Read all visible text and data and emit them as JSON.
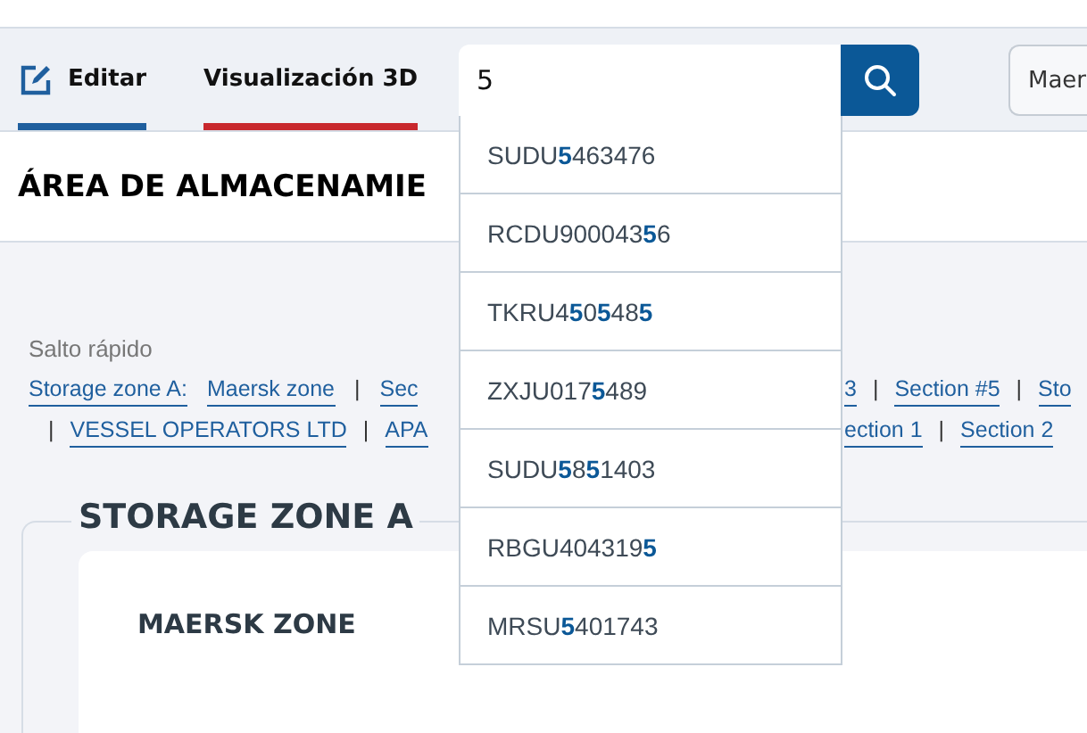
{
  "tabs": [
    {
      "label": "Editar",
      "kind": "edit",
      "selected": true
    },
    {
      "label": "Visualización 3D",
      "kind": "view",
      "selected": false
    }
  ],
  "search": {
    "value": "5"
  },
  "suggestions": [
    "SUDU**5**463476",
    "RCDU900043**5**6",
    "TKRU4**5**0**5**48**5**",
    "ZXJU017**5**489",
    "SUDU**5**8**5**1403",
    "RBGU404319**5**",
    "MRSU**5**401743"
  ],
  "toolbar_button": {
    "label": "Maer"
  },
  "page_title": "ÁREA DE ALMACENAMIE",
  "quick_jump": {
    "title": "Salto rápido",
    "lines": [
      {
        "before": [
          {
            "kind": "label",
            "text": "Storage zone A:"
          },
          {
            "kind": "link",
            "text": "Maersk zone"
          },
          {
            "kind": "separator",
            "text": "|"
          },
          {
            "kind": "link",
            "text": "Sec"
          }
        ],
        "after": [
          {
            "kind": "link",
            "text": "3"
          },
          {
            "kind": "separator",
            "text": "|"
          },
          {
            "kind": "link",
            "text": "Section #5"
          },
          {
            "kind": "separator",
            "text": "|"
          },
          {
            "kind": "link",
            "text": "Sto"
          }
        ]
      },
      {
        "before": [
          {
            "kind": "separator",
            "text": "|"
          },
          {
            "kind": "link",
            "text": "VESSEL OPERATORS LTD"
          },
          {
            "kind": "separator",
            "text": "|"
          },
          {
            "kind": "link",
            "text": "APA"
          }
        ],
        "after": [
          {
            "kind": "link",
            "text": "ection 1"
          },
          {
            "kind": "separator",
            "text": "|"
          },
          {
            "kind": "link",
            "text": "Section 2"
          }
        ]
      }
    ]
  },
  "zone": {
    "title": "STORAGE ZONE A",
    "subzone": "MAERSK ZONE"
  }
}
